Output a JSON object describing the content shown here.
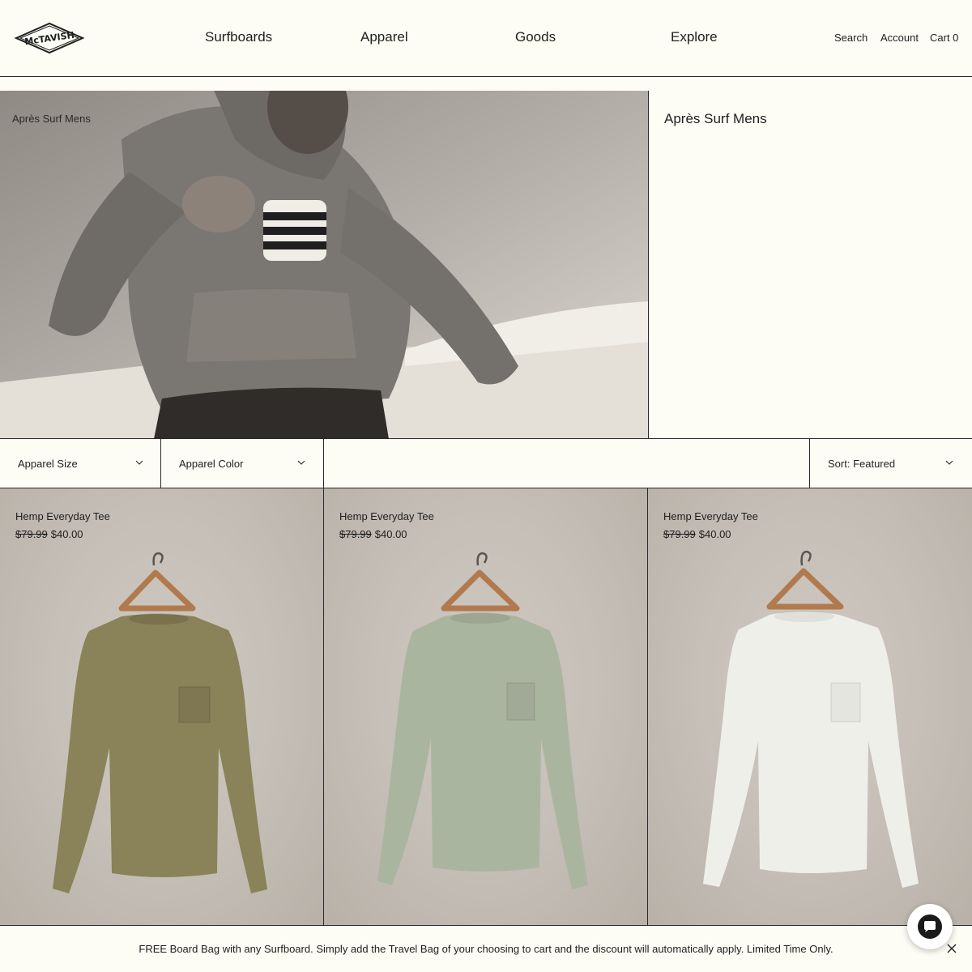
{
  "header": {
    "logo_text": "McTAVISH",
    "nav": [
      "Surfboards",
      "Apparel",
      "Goods",
      "Explore"
    ],
    "utilities": {
      "search": "Search",
      "account": "Account",
      "cart": "Cart 0"
    }
  },
  "hero": {
    "caption": "Après Surf Mens",
    "title": "Après Surf Mens"
  },
  "filters": {
    "size": "Apparel Size",
    "color": "Apparel Color",
    "sort": "Sort: Featured"
  },
  "products": [
    {
      "name": "Hemp Everyday Tee",
      "price_old": "$79.99",
      "price": "$40.00",
      "shirt_color": "#8a8258"
    },
    {
      "name": "Hemp Everyday Tee",
      "price_old": "$79.99",
      "price": "$40.00",
      "shirt_color": "#aab5a0"
    },
    {
      "name": "Hemp Everyday Tee",
      "price_old": "$79.99",
      "price": "$40.00",
      "shirt_color": "#efefe9"
    }
  ],
  "banner": {
    "text": "FREE Board Bag with any Surfboard. Simply add the Travel Bag of your choosing to cart and the discount will automatically apply. Limited Time Only."
  },
  "colors": {
    "background": "#fdfdf6",
    "border": "#2a2a2a",
    "text": "#1e1e1e"
  }
}
